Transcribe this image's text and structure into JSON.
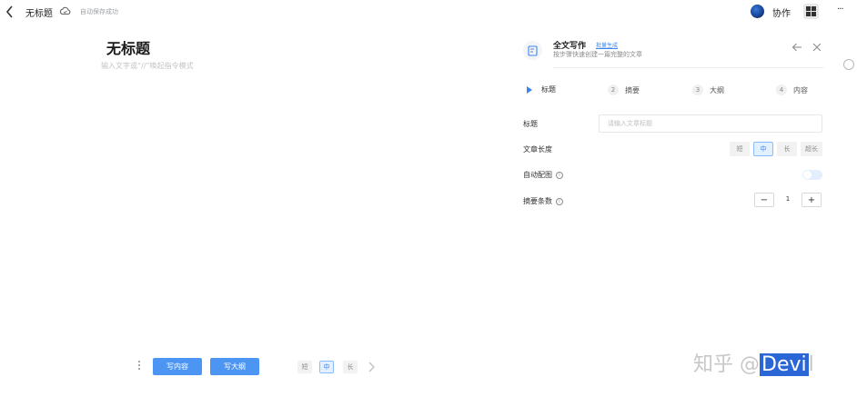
{
  "topbar": {
    "doc_name": "无标题",
    "save_status": "自动保存成功",
    "collab_label": "协作",
    "more_label": "···",
    "icons": {
      "back": "chevron-left-icon",
      "cloud": "cloud-icon",
      "grid": "grid-icon"
    }
  },
  "editor": {
    "title": "无标题",
    "placeholder": "输入文字或“//”唤起指令模式"
  },
  "bottom_toolbar": {
    "write_content": "写内容",
    "write_outline": "写大纲",
    "lengths": [
      "短",
      "中",
      "长"
    ],
    "active_length": "中"
  },
  "panel": {
    "title": "全文写作",
    "batch_link": "批量生成",
    "subtitle": "按步骤快速创建一篇完整的文章",
    "steps": [
      {
        "num": "",
        "label": "标题"
      },
      {
        "num": "2",
        "label": "摘要"
      },
      {
        "num": "3",
        "label": "大纲"
      },
      {
        "num": "4",
        "label": "内容"
      }
    ],
    "form": {
      "title_label": "标题",
      "title_placeholder": "请输入文章标题",
      "length_label": "文章长度",
      "length_options": [
        "短",
        "中",
        "长",
        "超长"
      ],
      "length_selected": "中",
      "auto_image_label": "自动配图",
      "auto_image_on": false,
      "summary_count_label": "摘要条数",
      "summary_count": "1",
      "minus": "−",
      "plus": "+"
    }
  },
  "watermark": {
    "prefix": "知乎 @",
    "highlight": "Devi",
    "suffix": "l"
  },
  "colors": {
    "accent": "#4d95f2",
    "link": "#3a86f0",
    "muted": "#8c8c8c"
  }
}
